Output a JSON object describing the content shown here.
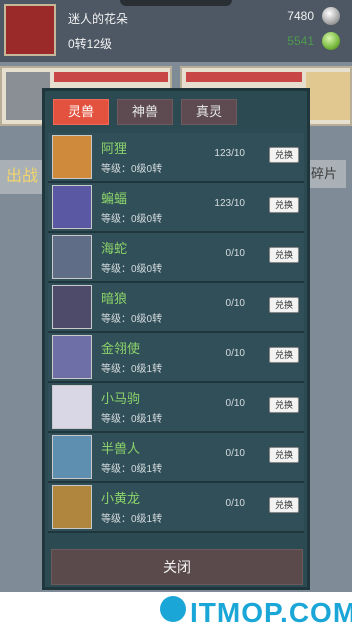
{
  "header": {
    "player_name": "迷人的花朵",
    "player_level": "0转12级",
    "coins": "7480",
    "gems": "5541"
  },
  "background": {
    "left_button": "出战",
    "right_button": "碎片"
  },
  "modal": {
    "tabs": [
      {
        "label": "灵兽",
        "active": true
      },
      {
        "label": "神兽",
        "active": false
      },
      {
        "label": "真灵",
        "active": false
      }
    ],
    "rows": [
      {
        "name": "阿狸",
        "level": "等级：0级0转",
        "fragments": "123/10",
        "button": "兑换",
        "portrait_color": "#cf8a3b"
      },
      {
        "name": "蝙蝠",
        "level": "等级：0级0转",
        "fragments": "123/10",
        "button": "兑换",
        "portrait_color": "#5a58a3"
      },
      {
        "name": "海蛇",
        "level": "等级：0级0转",
        "fragments": "0/10",
        "button": "兑换",
        "portrait_color": "#5f6e86"
      },
      {
        "name": "暗狼",
        "level": "等级：0级0转",
        "fragments": "0/10",
        "button": "兑换",
        "portrait_color": "#4e4a6a"
      },
      {
        "name": "金翎使",
        "level": "等级：0级1转",
        "fragments": "0/10",
        "button": "兑换",
        "portrait_color": "#6d6fa6"
      },
      {
        "name": "小马驹",
        "level": "等级：0级1转",
        "fragments": "0/10",
        "button": "兑换",
        "portrait_color": "#d9d7e6"
      },
      {
        "name": "半兽人",
        "level": "等级：0级1转",
        "fragments": "0/10",
        "button": "兑换",
        "portrait_color": "#5e8fb0"
      },
      {
        "name": "小黄龙",
        "level": "等级：0级1转",
        "fragments": "0/10",
        "button": "兑换",
        "portrait_color": "#b0863e"
      }
    ],
    "close_label": "关闭"
  },
  "watermark": {
    "text": "ITMOP.COM"
  }
}
